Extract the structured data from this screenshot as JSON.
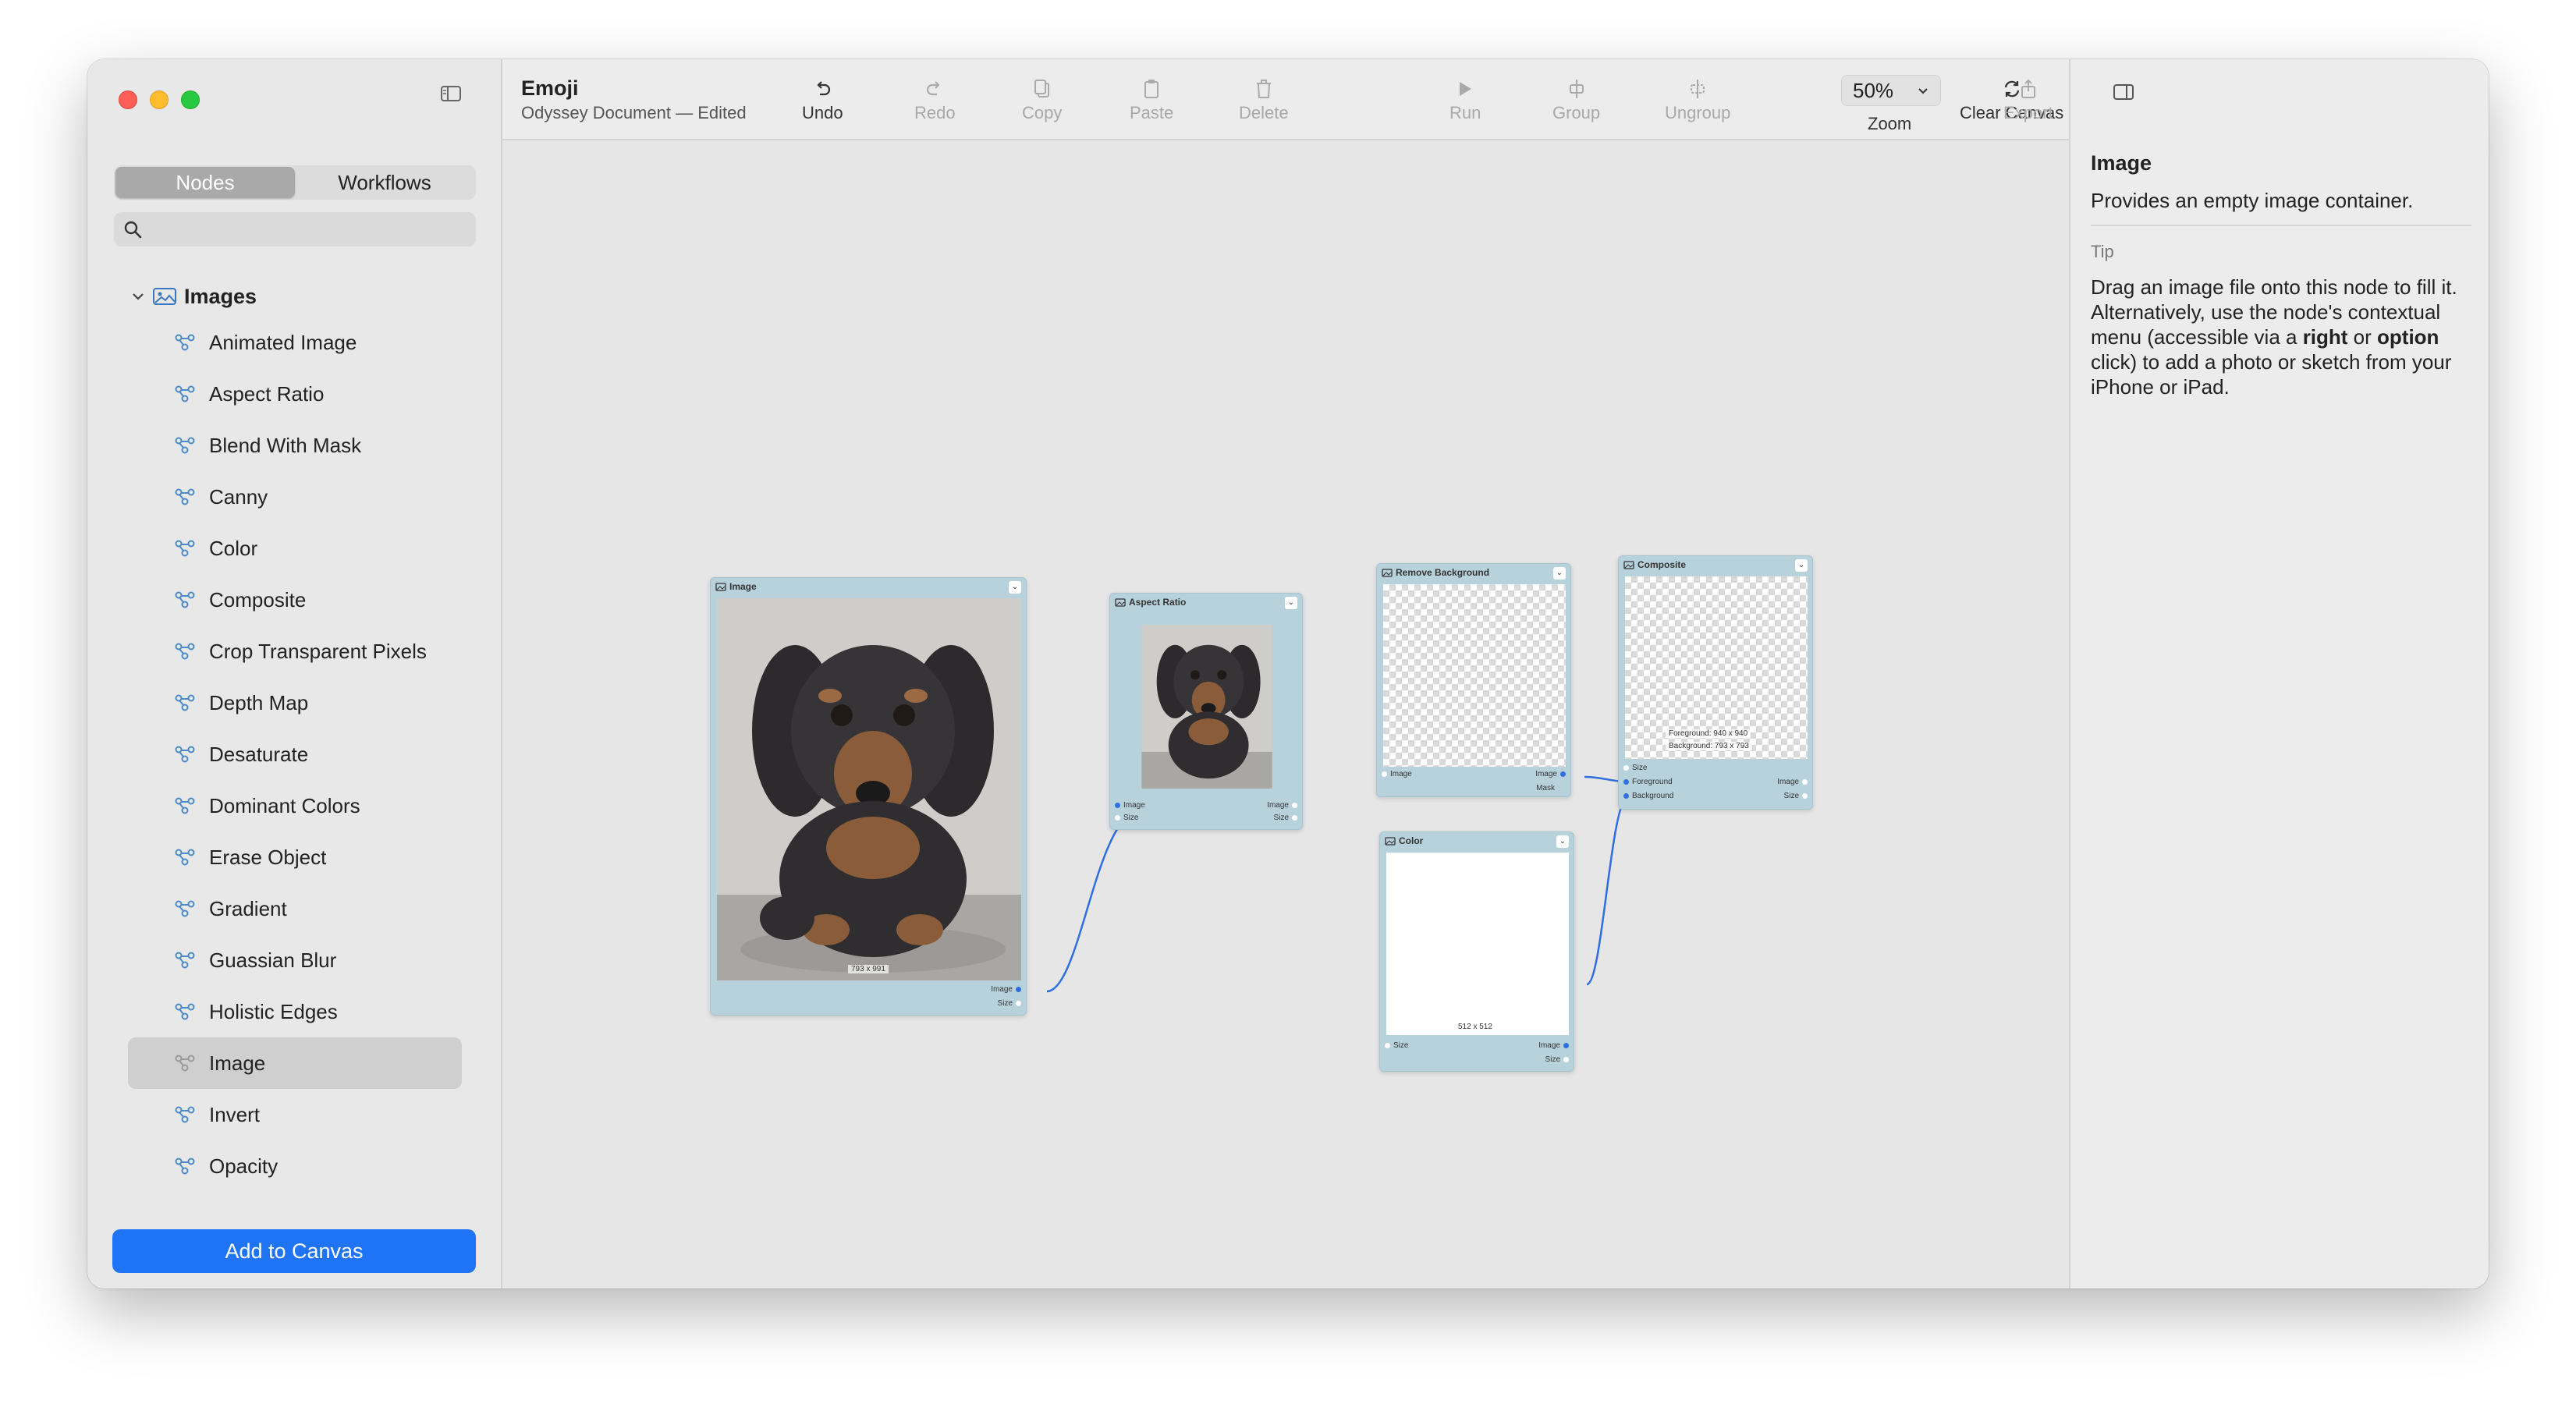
{
  "sidebar": {
    "tabs": [
      "Nodes",
      "Workflows"
    ],
    "active_tab": "Nodes",
    "search": {
      "placeholder": "",
      "value": ""
    },
    "group": {
      "label": "Images",
      "expanded": true
    },
    "items": [
      {
        "label": "Animated Image"
      },
      {
        "label": "Aspect Ratio"
      },
      {
        "label": "Blend With Mask"
      },
      {
        "label": "Canny"
      },
      {
        "label": "Color"
      },
      {
        "label": "Composite"
      },
      {
        "label": "Crop Transparent Pixels"
      },
      {
        "label": "Depth Map"
      },
      {
        "label": "Desaturate"
      },
      {
        "label": "Dominant Colors"
      },
      {
        "label": "Erase Object"
      },
      {
        "label": "Gradient"
      },
      {
        "label": "Guassian Blur"
      },
      {
        "label": "Holistic Edges"
      },
      {
        "label": "Image"
      },
      {
        "label": "Invert"
      },
      {
        "label": "Opacity"
      }
    ],
    "selected_item": "Image",
    "add_button": "Add to Canvas"
  },
  "toolbar": {
    "title": "Emoji",
    "subtitle": "Odyssey Document — Edited",
    "buttons": [
      {
        "label": "Undo",
        "icon": "undo-icon",
        "enabled": true
      },
      {
        "label": "Redo",
        "icon": "redo-icon",
        "enabled": false
      },
      {
        "label": "Copy",
        "icon": "copy-icon",
        "enabled": false
      },
      {
        "label": "Paste",
        "icon": "paste-icon",
        "enabled": false
      },
      {
        "label": "Delete",
        "icon": "trash-icon",
        "enabled": false
      },
      {
        "label": "Run",
        "icon": "play-icon",
        "enabled": false
      },
      {
        "label": "Group",
        "icon": "group-icon",
        "enabled": false
      },
      {
        "label": "Ungroup",
        "icon": "ungroup-icon",
        "enabled": false
      }
    ],
    "zoom": {
      "value": "50%",
      "label": "Zoom"
    },
    "clear_canvas": "Clear Canvas",
    "export": "Export"
  },
  "canvas": {
    "nodes": {
      "image": {
        "title": "Image",
        "size_label": "793 x 991",
        "outputs": [
          "Image",
          "Size"
        ]
      },
      "aspect": {
        "title": "Aspect Ratio",
        "inputs": [
          "Image",
          "Size"
        ],
        "outputs": [
          "Image",
          "Size"
        ]
      },
      "remove_bg": {
        "title": "Remove Background",
        "inputs": [
          "Image"
        ],
        "outputs": [
          "Image",
          "Mask"
        ]
      },
      "composite": {
        "title": "Composite",
        "info_line1": "Foreground: 940 x 940",
        "info_line2": "Background: 793 x 793",
        "inputs": [
          "Size",
          "Foreground",
          "Background"
        ],
        "outputs": [
          "Image",
          "Size"
        ]
      },
      "color": {
        "title": "Color",
        "size_label": "512 x 512",
        "inputs": [
          "Size"
        ],
        "outputs": [
          "Image",
          "Size"
        ]
      }
    }
  },
  "inspector": {
    "title": "Image",
    "description": "Provides an empty image container.",
    "tip_label": "Tip",
    "tip_p1": "Drag an image file onto this node to fill it. Alternatively, use the node's contextual menu (accessible via a ",
    "tip_right": "right",
    "tip_or": " or ",
    "tip_option": "option",
    "tip_p2": " click) to add a photo or sketch from your iPhone or iPad."
  },
  "colors": {
    "accent": "#1f74f5",
    "node_bg": "#b8d2dc",
    "connection": "#2f6fe0"
  }
}
